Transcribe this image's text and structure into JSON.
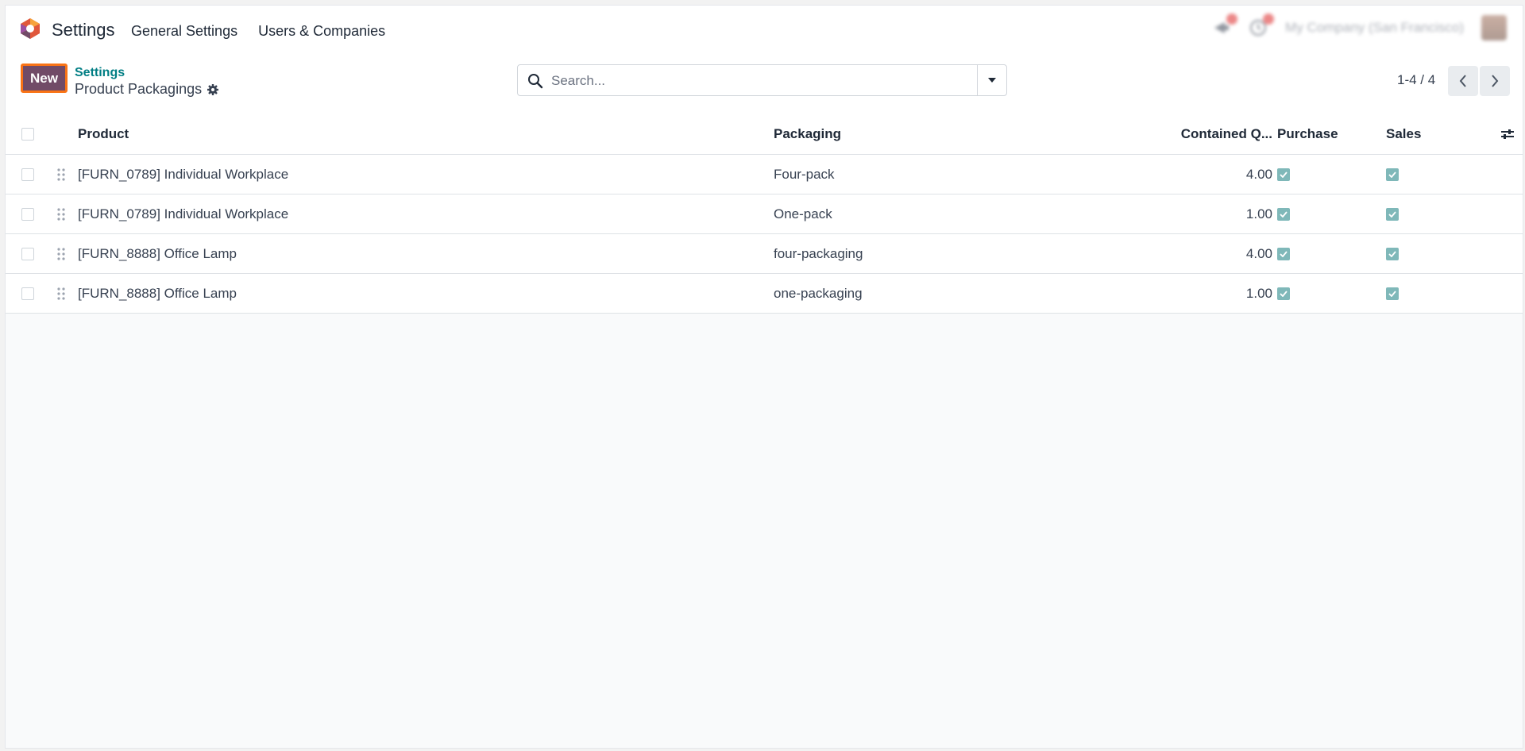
{
  "navbar": {
    "app_name": "Settings",
    "menu": [
      "General Settings",
      "Users & Companies"
    ],
    "company": "My Company (San Francisco)"
  },
  "control_panel": {
    "new_label": "New",
    "breadcrumb": "Settings",
    "title": "Product Packagings",
    "search_placeholder": "Search...",
    "pager": "1-4 / 4"
  },
  "table": {
    "columns": {
      "product": "Product",
      "packaging": "Packaging",
      "qty": "Contained Q...",
      "purchase": "Purchase",
      "sales": "Sales"
    },
    "rows": [
      {
        "product": "[FURN_0789] Individual Workplace",
        "packaging": "Four-pack",
        "qty": "4.00",
        "purchase": true,
        "sales": true
      },
      {
        "product": "[FURN_0789] Individual Workplace",
        "packaging": "One-pack",
        "qty": "1.00",
        "purchase": true,
        "sales": true
      },
      {
        "product": "[FURN_8888] Office Lamp",
        "packaging": "four-packaging",
        "qty": "4.00",
        "purchase": true,
        "sales": true
      },
      {
        "product": "[FURN_8888] Office Lamp",
        "packaging": "one-packaging",
        "qty": "1.00",
        "purchase": true,
        "sales": true
      }
    ]
  },
  "colors": {
    "brand": "#714b67",
    "link": "#017e84",
    "focus": "#f97316",
    "checked": "#7fb8b9"
  }
}
